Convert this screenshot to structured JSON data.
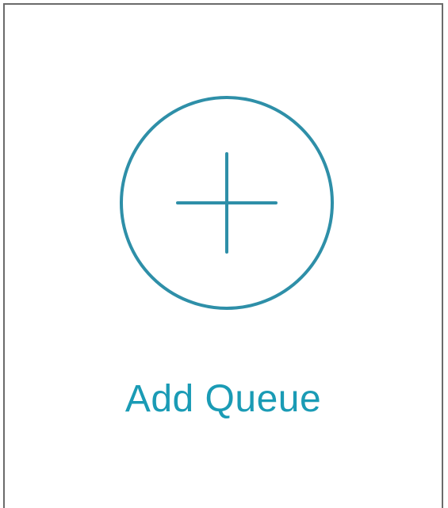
{
  "add_queue_card": {
    "label": "Add Queue",
    "icon": "plus-circle-icon",
    "accent_color": "#2e8fa8",
    "label_color": "#1a9bb5",
    "border_color": "#6b6b6b"
  }
}
